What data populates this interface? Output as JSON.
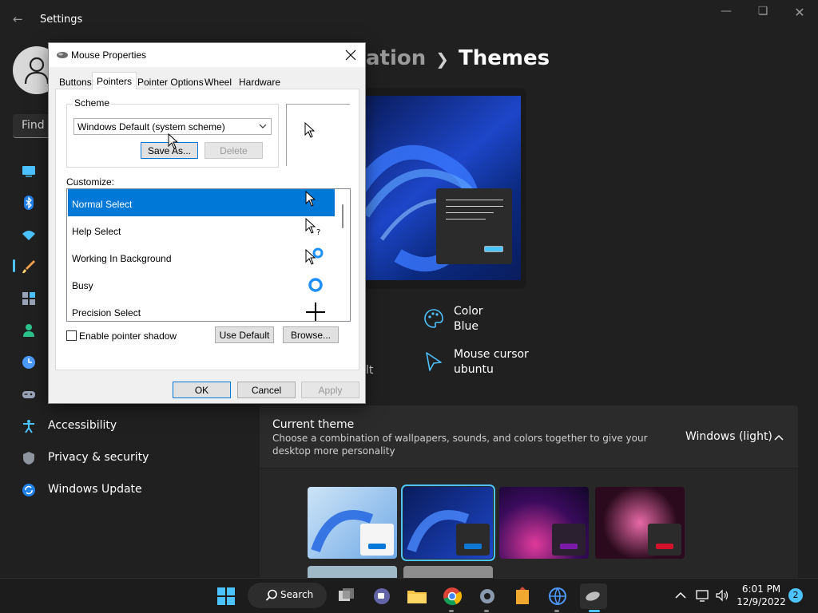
{
  "settings": {
    "app_title": "Settings",
    "search_placeholder": "Find a",
    "nav": [
      {
        "label": "Accessibility",
        "icon": "accessibility-icon"
      },
      {
        "label": "Privacy & security",
        "icon": "shield-icon"
      },
      {
        "label": "Windows Update",
        "icon": "update-icon"
      }
    ],
    "breadcrumb": {
      "parent": "ation",
      "current": "Themes"
    },
    "properties": [
      {
        "title": "Color",
        "value": "Blue",
        "icon": "palette-icon"
      },
      {
        "title": "Mouse cursor",
        "value": "ubuntu",
        "icon": "cursor-icon"
      }
    ],
    "partial_label": "lt",
    "current_theme": {
      "title": "Current theme",
      "description": "Choose a combination of wallpapers, sounds, and colors together to give your desktop more personality",
      "value": "Windows (light)"
    }
  },
  "dialog": {
    "title": "Mouse Properties",
    "tabs": [
      "Buttons",
      "Pointers",
      "Pointer Options",
      "Wheel",
      "Hardware"
    ],
    "active_tab": "Pointers",
    "scheme_label": "Scheme",
    "scheme_value": "Windows Default (system scheme)",
    "save_as": "Save As...",
    "delete": "Delete",
    "customize_label": "Customize:",
    "cursors": [
      {
        "label": "Normal Select",
        "icon": "arrow-cursor-icon"
      },
      {
        "label": "Help Select",
        "icon": "help-cursor-icon"
      },
      {
        "label": "Working In Background",
        "icon": "working-cursor-icon"
      },
      {
        "label": "Busy",
        "icon": "busy-cursor-icon"
      },
      {
        "label": "Precision Select",
        "icon": "crosshair-cursor-icon"
      }
    ],
    "shadow_label": "Enable pointer shadow",
    "shadow_checked": false,
    "use_default": "Use Default",
    "browse": "Browse...",
    "ok": "OK",
    "cancel": "Cancel",
    "apply": "Apply"
  },
  "taskbar": {
    "search_label": "Search",
    "time": "6:01 PM",
    "date": "12/9/2022",
    "notifications": "2"
  },
  "colors": {
    "accent": "#4cc2ff",
    "selection": "#0078d7",
    "background": "#202020"
  }
}
